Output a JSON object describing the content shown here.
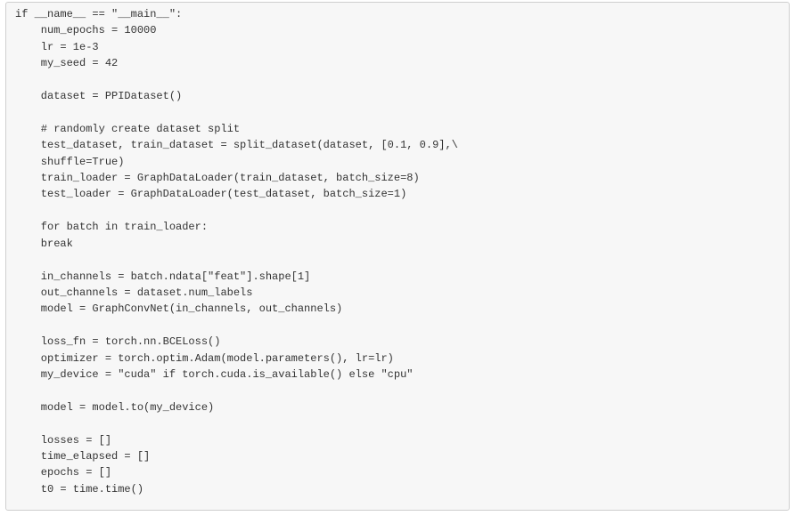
{
  "code": {
    "lines": [
      "if __name__ == \"__main__\":",
      "    num_epochs = 10000",
      "    lr = 1e-3",
      "    my_seed = 42",
      "",
      "    dataset = PPIDataset()",
      "",
      "    # randomly create dataset split",
      "    test_dataset, train_dataset = split_dataset(dataset, [0.1, 0.9],\\",
      "    shuffle=True)",
      "    train_loader = GraphDataLoader(train_dataset, batch_size=8)",
      "    test_loader = GraphDataLoader(test_dataset, batch_size=1)",
      "",
      "    for batch in train_loader:",
      "    break",
      "",
      "    in_channels = batch.ndata[\"feat\"].shape[1]",
      "    out_channels = dataset.num_labels",
      "    model = GraphConvNet(in_channels, out_channels)",
      "",
      "    loss_fn = torch.nn.BCELoss()",
      "    optimizer = torch.optim.Adam(model.parameters(), lr=lr)",
      "    my_device = \"cuda\" if torch.cuda.is_available() else \"cpu\"",
      "",
      "    model = model.to(my_device)",
      "",
      "    losses = []",
      "    time_elapsed = []",
      "    epochs = []",
      "    t0 = time.time()"
    ]
  }
}
